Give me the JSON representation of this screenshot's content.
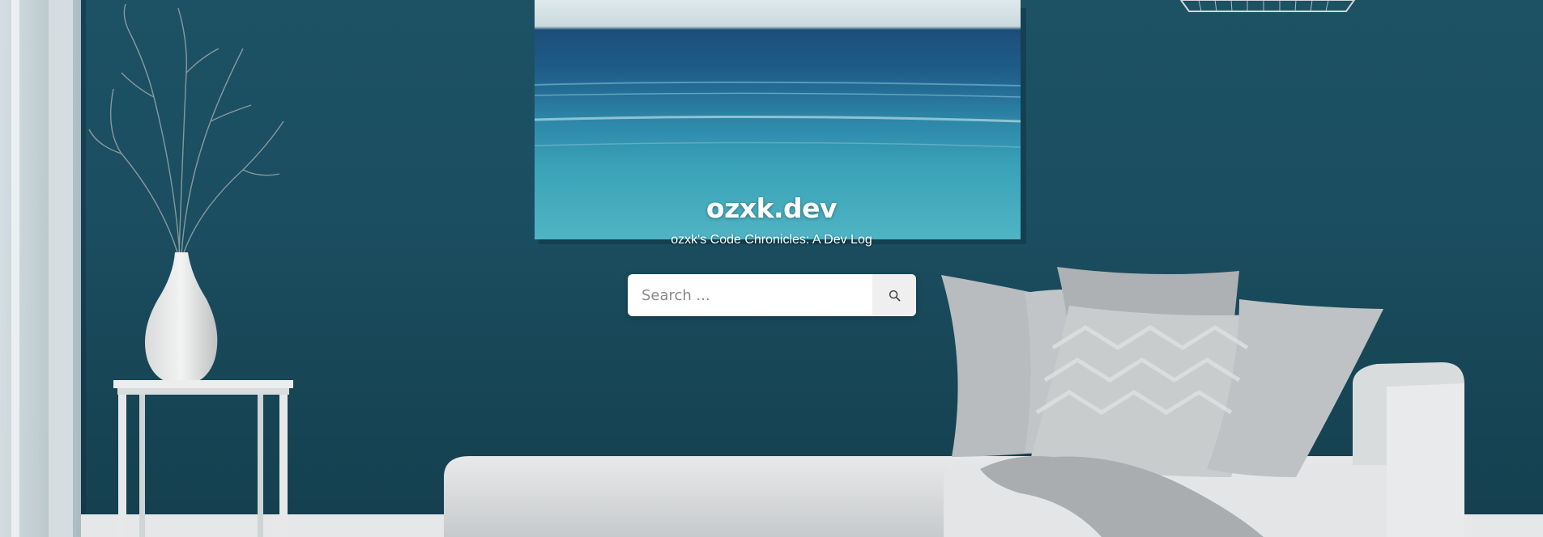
{
  "site": {
    "title": "ozxk.dev",
    "tagline": "ozxk's Code Chronicles: A Dev Log"
  },
  "search": {
    "placeholder": "Search ...",
    "value": "",
    "button_icon": "search-icon"
  },
  "colors": {
    "wall": "#1a4d5f",
    "text": "#ffffff",
    "search_bg": "#ffffff",
    "search_button_bg": "#efefef"
  }
}
